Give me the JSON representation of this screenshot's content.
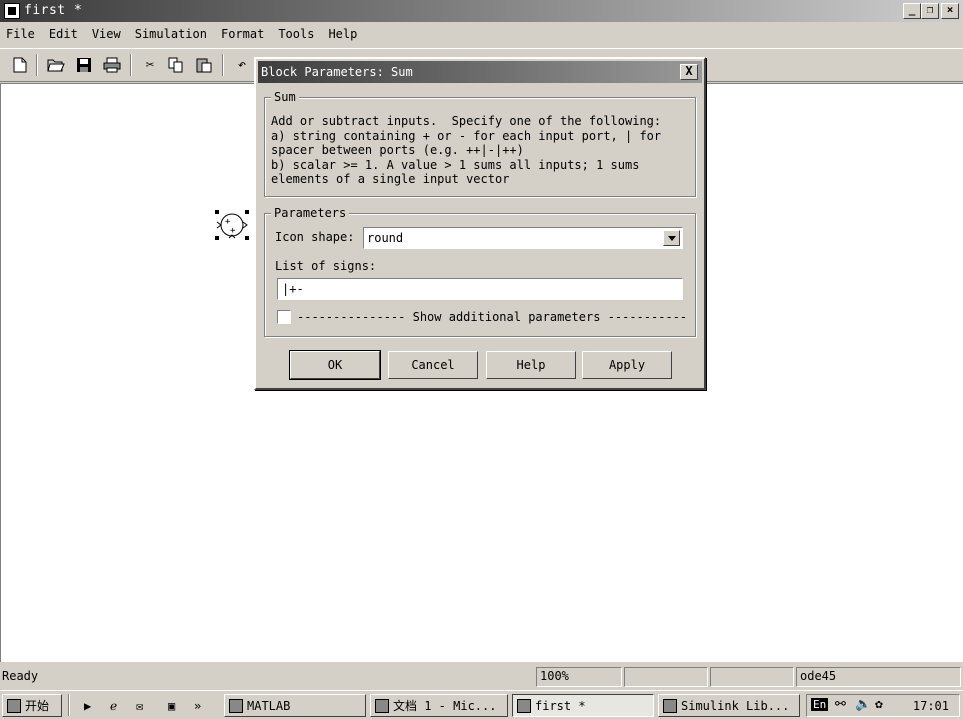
{
  "window": {
    "title": "first *"
  },
  "menu": [
    "File",
    "Edit",
    "View",
    "Simulation",
    "Format",
    "Tools",
    "Help"
  ],
  "statusbar": {
    "status": "Ready",
    "zoom": "100%",
    "cell2": "",
    "cell3": "",
    "solver": "ode45"
  },
  "taskbar": {
    "start": "开始",
    "tasks": [
      {
        "label": "MATLAB",
        "active": false
      },
      {
        "label": "文档 1 - Mic...",
        "active": false
      },
      {
        "label": "first *",
        "active": true
      },
      {
        "label": "Simulink Lib...",
        "active": false
      }
    ],
    "tray_lang": "En",
    "clock": "17:01"
  },
  "dialog": {
    "title": "Block Parameters: Sum",
    "close_label": "X",
    "group1_legend": "Sum",
    "description": "Add or subtract inputs.  Specify one of the following:\na) string containing + or - for each input port, | for\nspacer between ports (e.g. ++|-|++)\nb) scalar >= 1. A value > 1 sums all inputs; 1 sums\nelements of a single input vector",
    "group2_legend": "Parameters",
    "icon_shape_label": "Icon shape:",
    "icon_shape_value": "round",
    "signs_label": "List of signs:",
    "signs_value": "|+-",
    "show_additional": "--------------- Show additional parameters -----------",
    "buttons": {
      "ok": "OK",
      "cancel": "Cancel",
      "help": "Help",
      "apply": "Apply"
    }
  },
  "block": {
    "sign_plus1": "+",
    "sign_plus2": "+"
  }
}
